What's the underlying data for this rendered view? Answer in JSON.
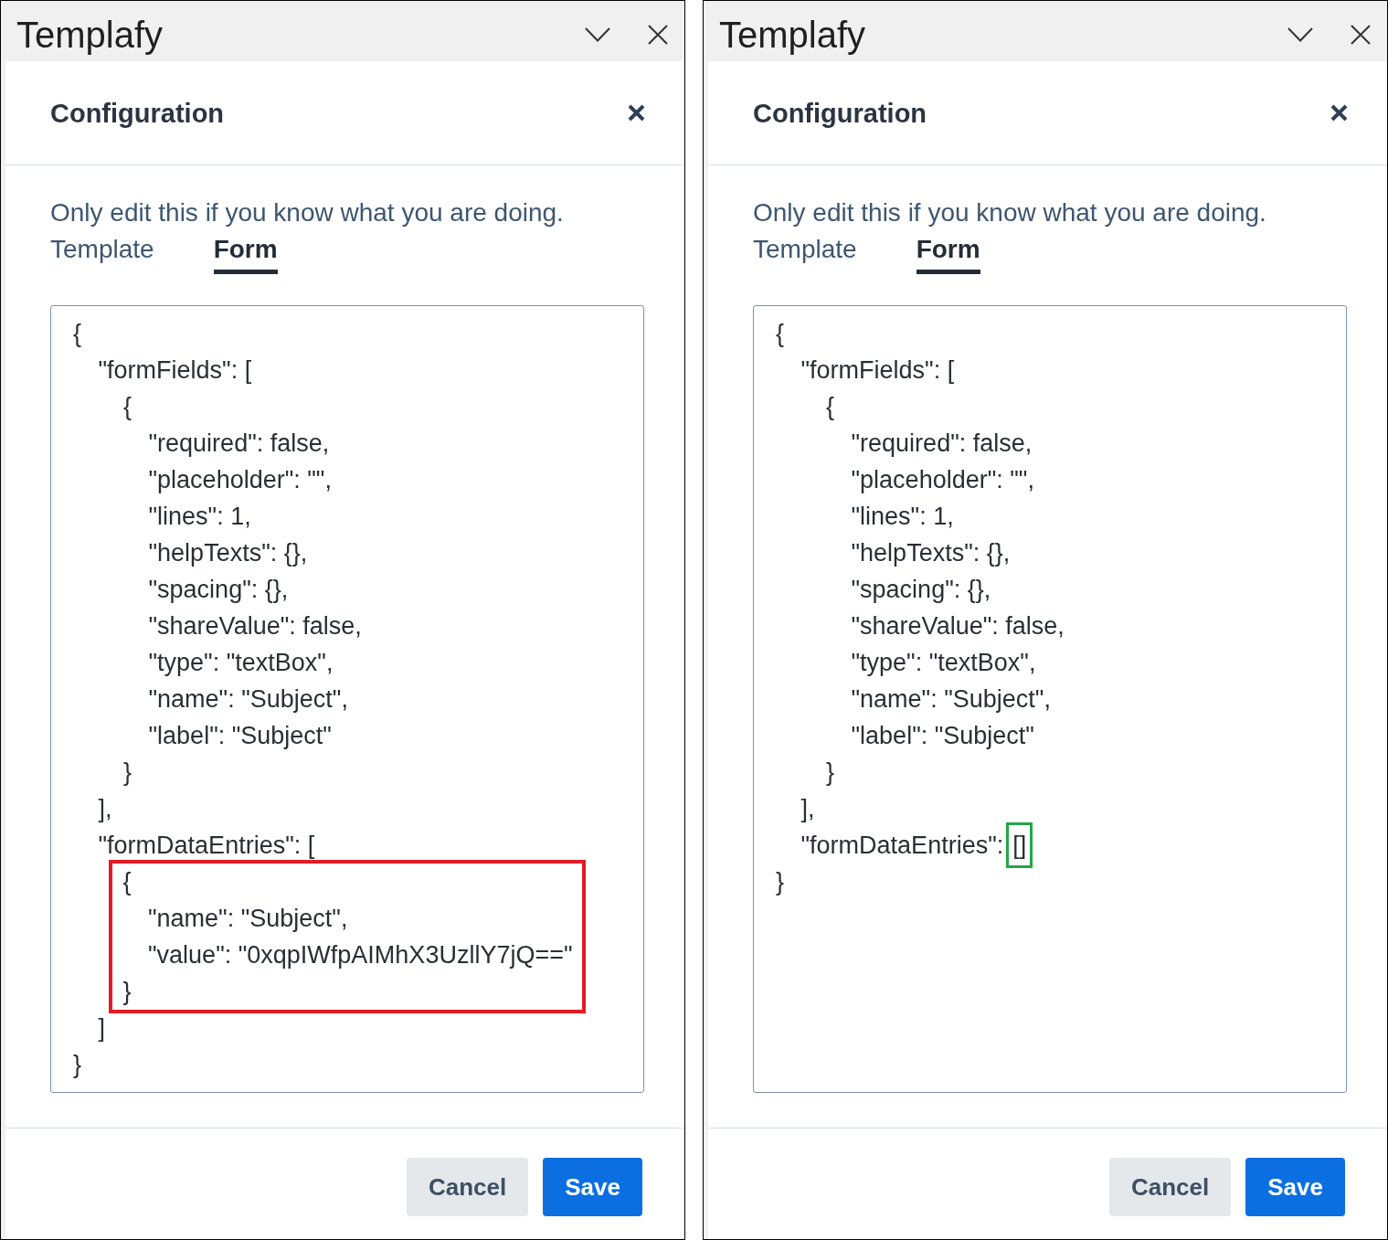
{
  "panels": [
    {
      "app_bar": {
        "title": "Templafy"
      },
      "dialog": {
        "title": "Configuration",
        "instruction": "Only edit this if you know what you are doing.",
        "tabs": [
          {
            "label": "Template",
            "selected": false
          },
          {
            "label": "Form",
            "selected": true
          }
        ],
        "code": [
          {
            "text": "{",
            "children": [
              {
                "text": "\"formFields\": [",
                "children": [
                  {
                    "text": "{",
                    "children": [
                      {
                        "text": "\"required\": false,"
                      },
                      {
                        "text": "\"placeholder\": \"\","
                      },
                      {
                        "text": "\"lines\": 1,"
                      },
                      {
                        "text": "\"helpTexts\": {},"
                      },
                      {
                        "text": "\"spacing\": {},"
                      },
                      {
                        "text": "\"shareValue\": false,"
                      },
                      {
                        "text": "\"type\": \"textBox\","
                      },
                      {
                        "text": "\"name\": \"Subject\","
                      },
                      {
                        "text": "\"label\": \"Subject\""
                      }
                    ]
                  },
                  {
                    "text": "}"
                  }
                ]
              },
              {
                "text": "],"
              },
              {
                "text": "\"formDataEntries\": [",
                "children_frame": {
                  "color": "#e31b23"
                },
                "children": [
                  {
                    "text": "{",
                    "children": [
                      {
                        "text": "\"name\": \"Subject\","
                      },
                      {
                        "text": "\"value\": \"0xqpIWfpAIMhX3UzllY7jQ==\""
                      }
                    ]
                  },
                  {
                    "text": "}"
                  }
                ]
              },
              {
                "text": "]"
              }
            ]
          },
          {
            "text": "}"
          }
        ],
        "buttons": [
          {
            "label": "Cancel",
            "kind": "secondary"
          },
          {
            "label": "Save",
            "kind": "primary"
          }
        ]
      }
    },
    {
      "app_bar": {
        "title": "Templafy"
      },
      "dialog": {
        "title": "Configuration",
        "instruction": "Only edit this if you know what you are doing.",
        "tabs": [
          {
            "label": "Template",
            "selected": false
          },
          {
            "label": "Form",
            "selected": true
          }
        ],
        "code": [
          {
            "text": "{",
            "children": [
              {
                "text": "\"formFields\": [",
                "children": [
                  {
                    "text": "{",
                    "children": [
                      {
                        "text": "\"required\": false,"
                      },
                      {
                        "text": "\"placeholder\": \"\","
                      },
                      {
                        "text": "\"lines\": 1,"
                      },
                      {
                        "text": "\"helpTexts\": {},"
                      },
                      {
                        "text": "\"spacing\": {},"
                      },
                      {
                        "text": "\"shareValue\": false,"
                      },
                      {
                        "text": "\"type\": \"textBox\","
                      },
                      {
                        "text": "\"name\": \"Subject\","
                      },
                      {
                        "text": "\"label\": \"Subject\""
                      }
                    ]
                  },
                  {
                    "text": "}"
                  }
                ]
              },
              {
                "text": "],"
              },
              {
                "text": "\"formDataEntries\":",
                "value": "[]",
                "value_frame": {
                  "color": "#22a746"
                }
              }
            ]
          },
          {
            "text": "}"
          }
        ],
        "buttons": [
          {
            "label": "Cancel",
            "kind": "secondary"
          },
          {
            "label": "Save",
            "kind": "primary"
          }
        ]
      }
    }
  ]
}
